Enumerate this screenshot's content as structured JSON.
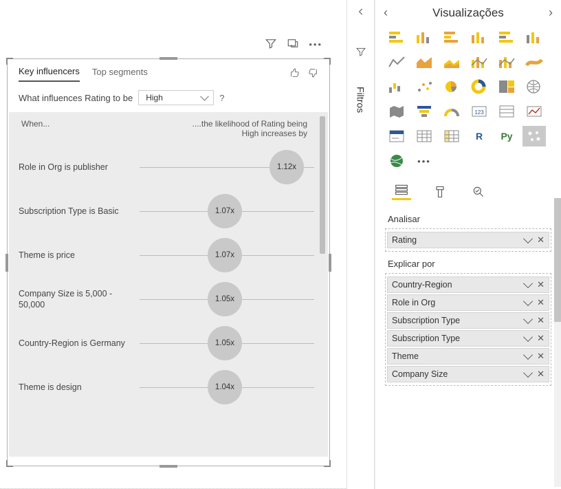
{
  "visual": {
    "tabs": {
      "key_influencers": "Key influencers",
      "top_segments": "Top segments"
    },
    "question_prefix": "What influences Rating to be",
    "dropdown_value": "High",
    "help": "?",
    "headers": {
      "when": "When...",
      "likelihood": "....the likelihood of Rating being High increases by"
    },
    "items": [
      {
        "label": "Role in Org is publisher",
        "value": "1.12x",
        "pos": 390
      },
      {
        "label": "Subscription Type is Basic",
        "value": "1.07x",
        "pos": 300
      },
      {
        "label": "Theme is price",
        "value": "1.07x",
        "pos": 300
      },
      {
        "label": "Company Size is 5,000 - 50,000",
        "value": "1.05x",
        "pos": 300
      },
      {
        "label": "Country-Region is Germany",
        "value": "1.05x",
        "pos": 300
      },
      {
        "label": "Theme is design",
        "value": "1.04x",
        "pos": 300
      }
    ]
  },
  "filters": {
    "title": "Filtros"
  },
  "viz_pane": {
    "title": "Visualizações",
    "analisar_label": "Analisar",
    "explicar_label": "Explicar por",
    "analisar_fields": [
      "Rating"
    ],
    "explicar_fields": [
      "Country-Region",
      "Role in Org",
      "Subscription Type",
      "Subscription Type",
      "Theme",
      "Company Size"
    ]
  }
}
